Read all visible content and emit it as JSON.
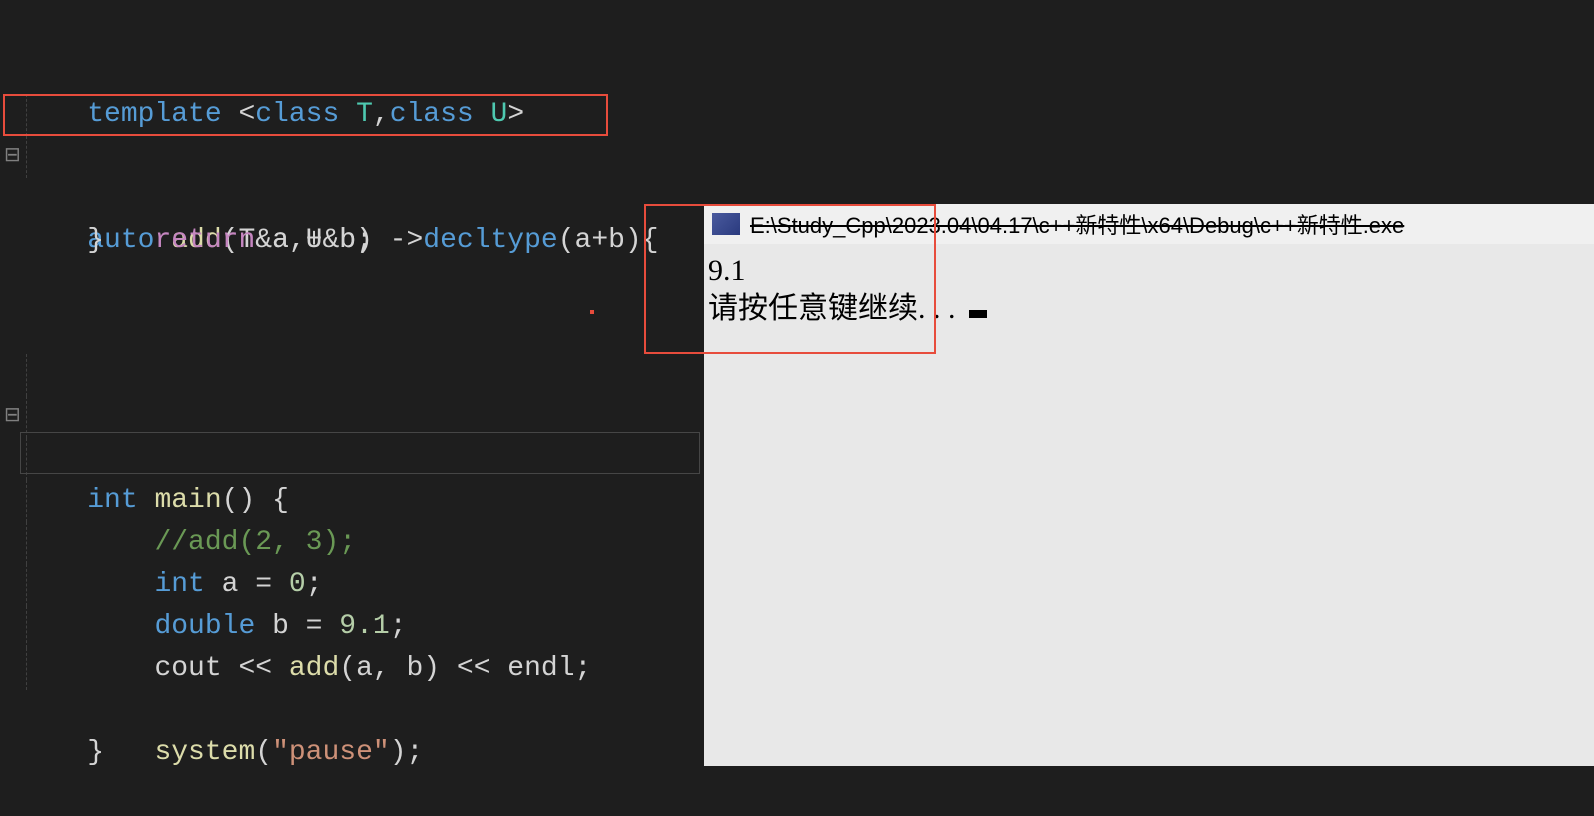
{
  "code": {
    "line1_template": "template",
    "line1_open": " <",
    "line1_class1": "class",
    "line1_T": " T",
    "line1_comma": ",",
    "line1_class2": "class",
    "line1_U": " U",
    "line1_close": ">",
    "line2_auto": "auto",
    "line2_add": " add",
    "line2_params": "(T&a,U&b) ->",
    "line2_decltype": "decltype",
    "line2_end": "(a+b){",
    "line3_return": "return",
    "line3_expr": " a + b;",
    "line4_brace": "}",
    "line7_int": "int",
    "line7_main": " main",
    "line7_rest": "() {",
    "line9_comment": "//add(2, 3);",
    "line10_int": "int",
    "line10_rest": " a = ",
    "line10_num": "0",
    "line10_semi": ";",
    "line11_double": "double",
    "line11_rest": " b = ",
    "line11_num": "9.1",
    "line11_semi": ";",
    "line12_cout": "cout << ",
    "line12_add": "add",
    "line12_args": "(a, b) << endl;",
    "line14_system": "system",
    "line14_paren": "(",
    "line14_str": "\"pause\"",
    "line14_end": ");",
    "line15_brace": "}"
  },
  "console": {
    "title": "E:\\Study_Cpp\\2023.04\\04.17\\c++新特性\\x64\\Debug\\c++新特性.exe",
    "output1": "9.1",
    "output2": "请按任意键继续. . . "
  }
}
